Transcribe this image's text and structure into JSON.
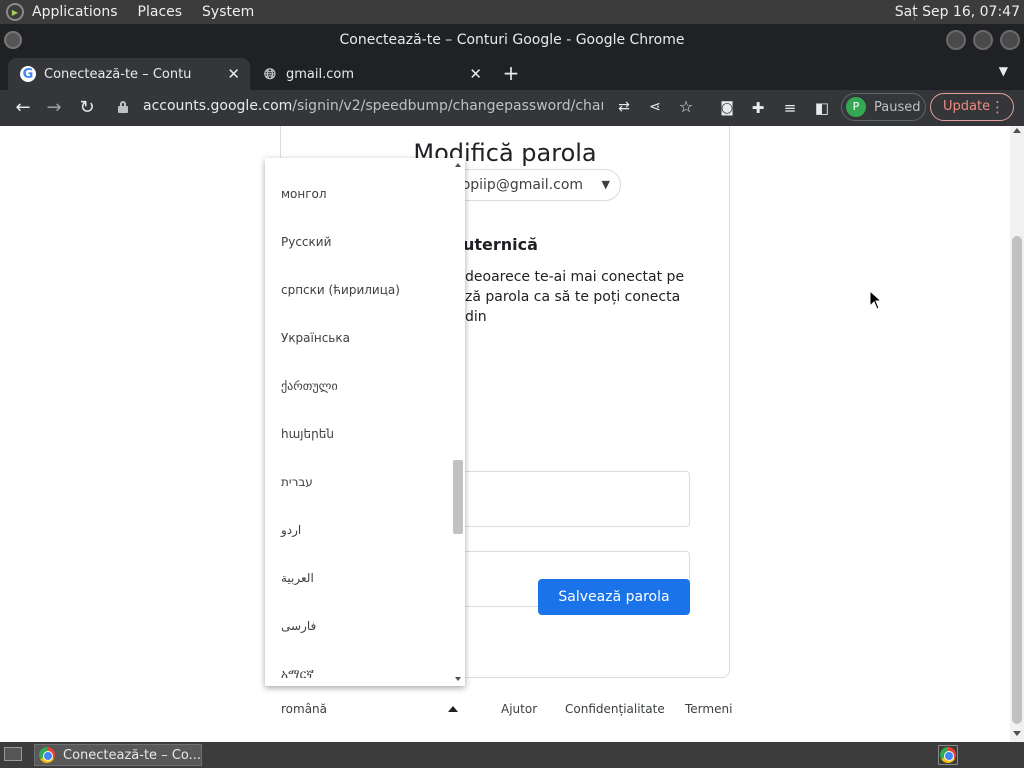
{
  "system_panel": {
    "menus": [
      "Applications",
      "Places",
      "System"
    ],
    "clock": "Sat Sep 16, 07:47"
  },
  "window": {
    "title": "Conectează-te – Conturi Google - Google Chrome"
  },
  "tabs": [
    {
      "label": "Conectează-te – Conturi Google",
      "active": true,
      "icon": "google-g-icon"
    },
    {
      "label": "gmail.com",
      "active": false,
      "icon": "globe-icon"
    }
  ],
  "toolbar": {
    "url_host": "accounts.google.com",
    "url_path": "/signin/v2/speedbump/changepassword/changepa...",
    "profile_initial": "P",
    "profile_status": "Paused",
    "update_label": "Update"
  },
  "card": {
    "title": "Modifică parola",
    "email": "copiip@gmail.com",
    "subheading": "uternică",
    "description": "deoarece te-ai mai conectat pe ză parola ca să te poți conecta din",
    "save_label": "Salvează parola"
  },
  "language_dropdown": {
    "items": [
      "монгол",
      "Русский",
      "српски (ћирилица)",
      "Українська",
      "ქართული",
      "հայերեն",
      "עברית",
      "اردو",
      "العربية",
      "فارسی",
      "አማርኛ"
    ]
  },
  "footer": {
    "language": "română",
    "links": [
      "Ajutor",
      "Confidențialitate",
      "Termeni"
    ]
  },
  "taskbar": {
    "window_label": "Conectează-te – Co..."
  },
  "colors": {
    "accent": "#1a73e8",
    "chrome_dark": "#202124",
    "toolbar": "#35363a",
    "profile_green": "#34a853",
    "update_red": "#f28b82"
  }
}
